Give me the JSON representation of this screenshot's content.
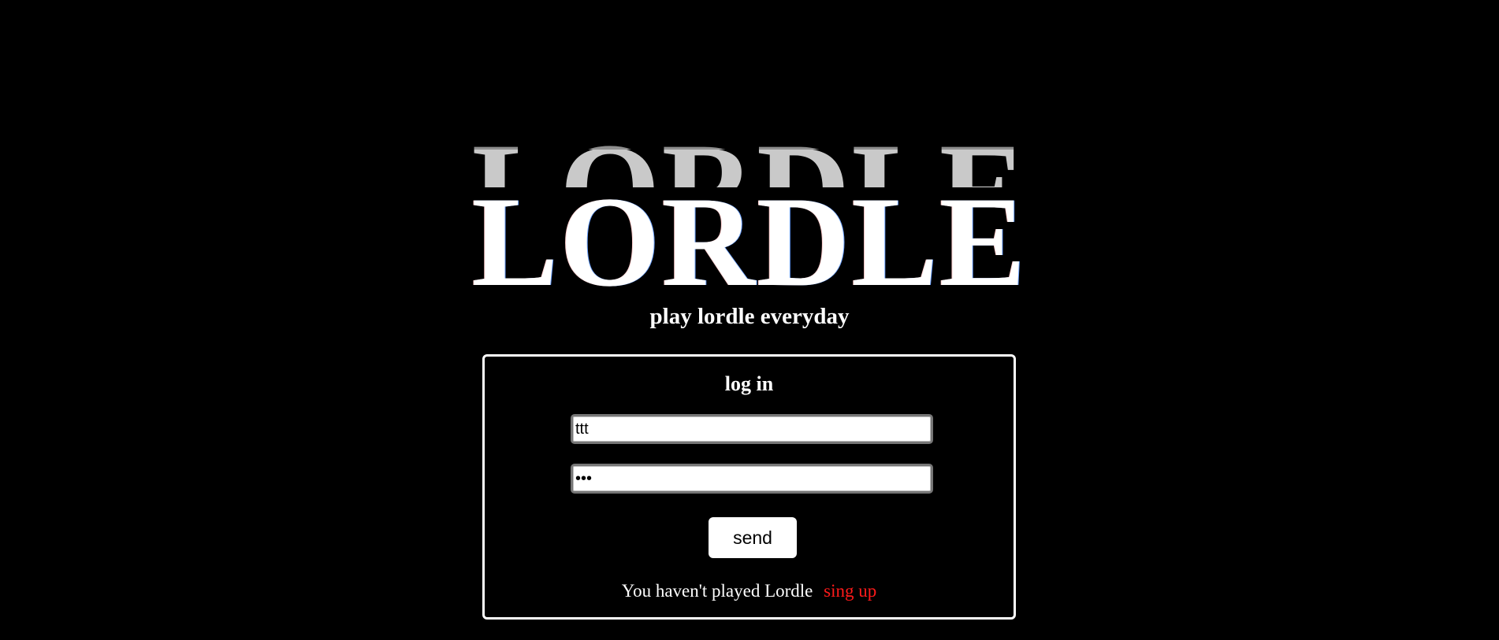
{
  "logo": {
    "text": "LORDLE"
  },
  "tagline": "play lordle everyday",
  "login": {
    "title": "log in",
    "username_value": "ttt",
    "password_value": "ttt",
    "send_label": "send",
    "prompt_text": "You haven't played Lordle",
    "signup_label": "sing up"
  },
  "colors": {
    "background": "#000000",
    "text": "#ffffff",
    "link": "#ff1a1a",
    "logo_ghost_dark": "#8f8f8f",
    "logo_ghost_light": "#c9c9c9"
  }
}
